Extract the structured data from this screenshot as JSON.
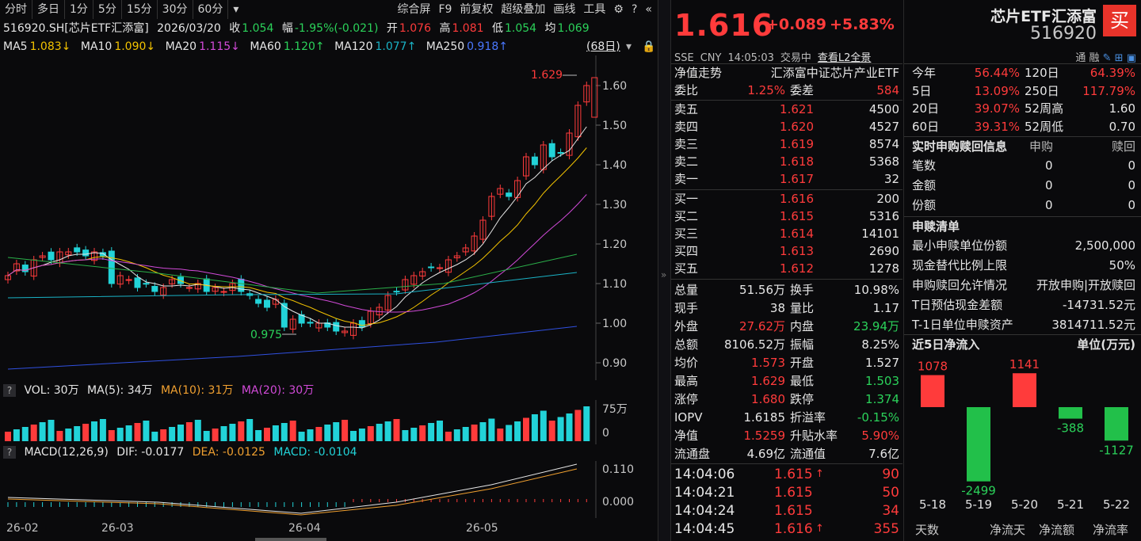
{
  "toolbar": {
    "tabs": [
      "分时",
      "多日",
      "1分",
      "5分",
      "15分",
      "30分",
      "60分"
    ],
    "dropdown": "▾",
    "right": [
      "综合屏",
      "F9",
      "前复权",
      "超级叠加",
      "画线",
      "工具"
    ]
  },
  "info": {
    "code": "516920.SH[芯片ETF汇添富]",
    "date": "2026/03/20",
    "close_l": "收",
    "close": "1.054",
    "amp_l": "幅",
    "amp": "-1.95%(-0.021)",
    "open_l": "开",
    "open": "1.076",
    "high_l": "高",
    "high": "1.081",
    "low_l": "低",
    "low": "1.054",
    "avg_l": "均",
    "avg": "1.069"
  },
  "ma": {
    "ma5": "MA5",
    "ma5v": "1.083↓",
    "ma10": "MA10",
    "ma10v": "1.090↓",
    "ma20": "MA20",
    "ma20v": "1.115↓",
    "ma60": "MA60",
    "ma60v": "1.120↑",
    "ma120": "MA120",
    "ma120v": "1.077↑",
    "ma250": "MA250",
    "ma250v": "0.918↑",
    "days": "(68日)"
  },
  "kaxis": [
    "1.60",
    "1.50",
    "1.40",
    "1.30",
    "1.20",
    "1.10",
    "1.00",
    "0.90"
  ],
  "kmarks": {
    "hi": "1.629",
    "lo": "0.975"
  },
  "vol": {
    "q": "?",
    "label": "VOL: 30万",
    "ma5": "MA(5): 34万",
    "ma10": "MA(10): 31万",
    "ma20": "MA(20): 30万",
    "ax_top": "75万",
    "ax_zero": "0"
  },
  "macd": {
    "q": "?",
    "label": "MACD(12,26,9)",
    "dif": "DIF: -0.0177",
    "dea": "DEA: -0.0125",
    "macd": "MACD: -0.0104",
    "ax_top": "0.110",
    "ax_zero": "0.000"
  },
  "dates": [
    "26-02",
    "26-03",
    "26-04",
    "26-05"
  ],
  "quote": {
    "price": "1.616",
    "chg": "+0.089",
    "pct": "+5.83%",
    "exch": "SSE",
    "cur": "CNY",
    "time": "14:05:03",
    "state": "交易中",
    "l2": "查看L2全景"
  },
  "nav": {
    "label": "净值走势",
    "name": "汇添富中证芯片产业ETF"
  },
  "wb": {
    "l1": "委比",
    "v1": "1.25%",
    "l2": "委差",
    "v2": "584"
  },
  "sells": [
    {
      "l": "卖五",
      "p": "1.621",
      "v": "4500"
    },
    {
      "l": "卖四",
      "p": "1.620",
      "v": "4527"
    },
    {
      "l": "卖三",
      "p": "1.619",
      "v": "8574"
    },
    {
      "l": "卖二",
      "p": "1.618",
      "v": "5368"
    },
    {
      "l": "卖一",
      "p": "1.617",
      "v": "32"
    }
  ],
  "buys": [
    {
      "l": "买一",
      "p": "1.616",
      "v": "200"
    },
    {
      "l": "买二",
      "p": "1.615",
      "v": "5316"
    },
    {
      "l": "买三",
      "p": "1.614",
      "v": "14101"
    },
    {
      "l": "买四",
      "p": "1.613",
      "v": "2690"
    },
    {
      "l": "买五",
      "p": "1.612",
      "v": "1278"
    }
  ],
  "stats": [
    {
      "l1": "总量",
      "v1": "51.56万",
      "l2": "换手",
      "v2": "10.98%",
      "c1": "white",
      "c2": "white"
    },
    {
      "l1": "现手",
      "v1": "38",
      "l2": "量比",
      "v2": "1.17",
      "c1": "white",
      "c2": "white"
    },
    {
      "l1": "外盘",
      "v1": "27.62万",
      "l2": "内盘",
      "v2": "23.94万",
      "c1": "red",
      "c2": "green"
    },
    {
      "l1": "总额",
      "v1": "8106.52万",
      "l2": "振幅",
      "v2": "8.25%",
      "c1": "white",
      "c2": "white"
    },
    {
      "l1": "均价",
      "v1": "1.573",
      "l2": "开盘",
      "v2": "1.527",
      "c1": "red",
      "c2": "white"
    },
    {
      "l1": "最高",
      "v1": "1.629",
      "l2": "最低",
      "v2": "1.503",
      "c1": "red",
      "c2": "green"
    },
    {
      "l1": "涨停",
      "v1": "1.680",
      "l2": "跌停",
      "v2": "1.374",
      "c1": "red",
      "c2": "green"
    },
    {
      "l1": "IOPV",
      "v1": "1.6185",
      "l2": "折溢率",
      "v2": "-0.15%",
      "c1": "white",
      "c2": "green"
    },
    {
      "l1": "净值",
      "v1": "1.5259",
      "l2": "升贴水率",
      "v2": "5.90%",
      "c1": "red",
      "c2": "red"
    },
    {
      "l1": "流通盘",
      "v1": "4.69亿",
      "l2": "流通值",
      "v2": "7.6亿",
      "c1": "white",
      "c2": "white"
    }
  ],
  "ticks": [
    {
      "t": "14:04:06",
      "p": "1.615",
      "a": "↑",
      "v": "90"
    },
    {
      "t": "14:04:21",
      "p": "1.615",
      "a": "",
      "v": "50"
    },
    {
      "t": "14:04:24",
      "p": "1.615",
      "a": "",
      "v": "34"
    },
    {
      "t": "14:04:45",
      "p": "1.616",
      "a": "↑",
      "v": "355"
    }
  ],
  "header": {
    "title": "芯片ETF汇添富",
    "code": "516920",
    "buy": "买",
    "tag": "通 融"
  },
  "perf": [
    {
      "l1": "今年",
      "v1": "56.44%",
      "l2": "120日",
      "v2": "64.39%",
      "c1": "red",
      "c2": "red"
    },
    {
      "l1": "5日",
      "v1": "13.09%",
      "l2": "250日",
      "v2": "117.79%",
      "c1": "red",
      "c2": "red"
    },
    {
      "l1": "20日",
      "v1": "39.07%",
      "l2": "52周高",
      "v2": "1.60",
      "c1": "red",
      "c2": "white"
    },
    {
      "l1": "60日",
      "v1": "39.31%",
      "l2": "52周低",
      "v2": "0.70",
      "c1": "red",
      "c2": "white"
    }
  ],
  "sg": {
    "title": "实时申购赎回信息",
    "h1": "申购",
    "h2": "赎回",
    "rows": [
      {
        "l": "笔数",
        "a": "0",
        "b": "0"
      },
      {
        "l": "金额",
        "a": "0",
        "b": "0"
      },
      {
        "l": "份额",
        "a": "0",
        "b": "0"
      }
    ]
  },
  "list": {
    "title": "申赎清单",
    "rows": [
      {
        "l": "最小申赎单位份额",
        "v": "2,500,000"
      },
      {
        "l": "现金替代比例上限",
        "v": "50%"
      },
      {
        "l": "申购赎回允许情况",
        "v": "开放申购|开放赎回"
      },
      {
        "l": "T日预估现金差额",
        "v": "-14731.52元"
      },
      {
        "l": "T-1日单位申赎资产",
        "v": "3814711.52元"
      }
    ]
  },
  "flow": {
    "title": "近5日净流入",
    "unit": "单位(万元)",
    "foot": [
      "天数",
      "净流天",
      "净流额",
      "净流率"
    ]
  },
  "chart_data": [
    {
      "type": "bar",
      "title": "近5日净流入",
      "categories": [
        "5-18",
        "5-19",
        "5-20",
        "5-21",
        "5-22"
      ],
      "values": [
        1078,
        -2499,
        1141,
        -388,
        -1127
      ],
      "ylabel": "单位(万元)"
    },
    {
      "type": "line",
      "title": "",
      "series": [
        {
          "name": "MA5",
          "value": "1.083"
        },
        {
          "name": "MA10",
          "value": "1.090"
        },
        {
          "name": "MA20",
          "value": "1.115"
        },
        {
          "name": "MA60",
          "value": "1.120"
        },
        {
          "name": "MA120",
          "value": "1.077"
        },
        {
          "name": "MA250",
          "value": "0.918"
        }
      ],
      "ylim": [
        0.88,
        1.64
      ]
    }
  ],
  "colors": {
    "up": "#ff3b3b",
    "down": "#22d3d8",
    "green": "#2bd25a",
    "ma5": "#e6e6e6",
    "ma10": "#f2c200",
    "ma20": "#d14ad8",
    "ma60": "#2bb04a",
    "ma120": "#1ab3c6",
    "ma250": "#3050e0"
  }
}
